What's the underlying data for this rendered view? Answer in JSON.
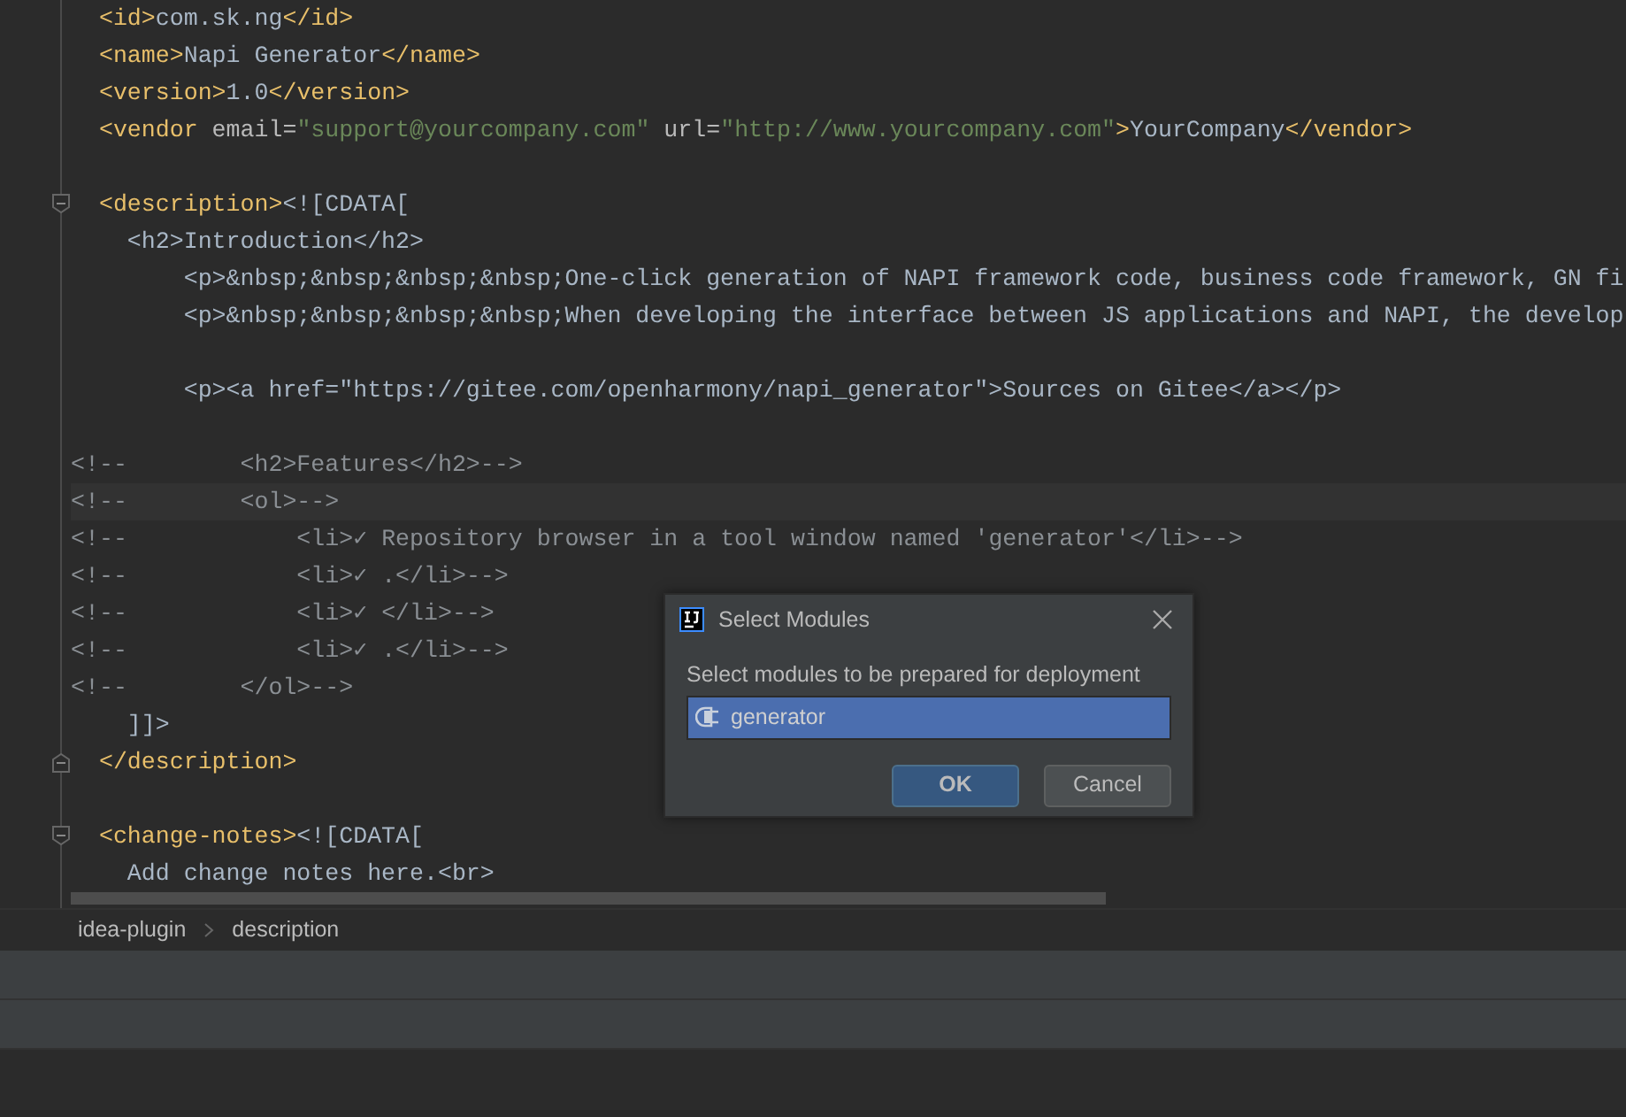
{
  "editor": {
    "lines": [
      {
        "kind": "code",
        "segments": [
          {
            "kind": "tag",
            "text": "  <id>"
          },
          {
            "kind": "text",
            "text": "com.sk.ng"
          },
          {
            "kind": "tag",
            "text": "</id>"
          }
        ]
      },
      {
        "kind": "code",
        "segments": [
          {
            "kind": "tag",
            "text": "  <name>"
          },
          {
            "kind": "text",
            "text": "Napi Generator"
          },
          {
            "kind": "tag",
            "text": "</name>"
          }
        ]
      },
      {
        "kind": "code",
        "segments": [
          {
            "kind": "tag",
            "text": "  <version>"
          },
          {
            "kind": "text",
            "text": "1.0"
          },
          {
            "kind": "tag",
            "text": "</version>"
          }
        ]
      },
      {
        "kind": "code",
        "segments": [
          {
            "kind": "tag",
            "text": "  <vendor"
          },
          {
            "kind": "attr",
            "text": " email="
          },
          {
            "kind": "string",
            "text": "\"support@yourcompany.com\""
          },
          {
            "kind": "attr",
            "text": " url="
          },
          {
            "kind": "string",
            "text": "\"http://www.yourcompany.com\""
          },
          {
            "kind": "tag",
            "text": ">"
          },
          {
            "kind": "text",
            "text": "YourCompany"
          },
          {
            "kind": "tag",
            "text": "</vendor>"
          }
        ]
      },
      {
        "kind": "blank"
      },
      {
        "kind": "code",
        "fold_start": true,
        "segments": [
          {
            "kind": "tag",
            "text": "  <description>"
          },
          {
            "kind": "text",
            "text": "<![CDATA["
          }
        ]
      },
      {
        "kind": "code",
        "segments": [
          {
            "kind": "text",
            "text": "    <h2>Introduction</h2>"
          }
        ]
      },
      {
        "kind": "code",
        "segments": [
          {
            "kind": "text",
            "text": "        <p>&nbsp;&nbsp;&nbsp;&nbsp;One-click generation of NAPI framework code, business code framework, GN fi"
          }
        ]
      },
      {
        "kind": "code",
        "segments": [
          {
            "kind": "text",
            "text": "        <p>&nbsp;&nbsp;&nbsp;&nbsp;When developing the interface between JS applications and NAPI, the develop"
          }
        ]
      },
      {
        "kind": "blank"
      },
      {
        "kind": "code",
        "segments": [
          {
            "kind": "text",
            "text": "        <p><a href=\"https://gitee.com/openharmony/napi_generator\">Sources on Gitee</a></p>"
          }
        ]
      },
      {
        "kind": "blank"
      },
      {
        "kind": "code",
        "segments": [
          {
            "kind": "comment",
            "text": "<!--        <h2>Features</h2>-->"
          }
        ]
      },
      {
        "kind": "code",
        "current": true,
        "segments": [
          {
            "kind": "comment",
            "text": "<!--        <ol>-->"
          }
        ]
      },
      {
        "kind": "code",
        "segments": [
          {
            "kind": "comment",
            "text": "<!--            <li>✓ Repository browser in a tool window named 'generator'</li>-->"
          }
        ]
      },
      {
        "kind": "code",
        "segments": [
          {
            "kind": "comment",
            "text": "<!--            <li>✓ .</li>-->"
          }
        ]
      },
      {
        "kind": "code",
        "segments": [
          {
            "kind": "comment",
            "text": "<!--            <li>✓ </li>-->"
          }
        ]
      },
      {
        "kind": "code",
        "segments": [
          {
            "kind": "comment",
            "text": "<!--            <li>✓ .</li>-->"
          }
        ]
      },
      {
        "kind": "code",
        "segments": [
          {
            "kind": "comment",
            "text": "<!--        </ol>-->"
          }
        ]
      },
      {
        "kind": "code",
        "segments": [
          {
            "kind": "text",
            "text": "    ]]>"
          }
        ]
      },
      {
        "kind": "code",
        "fold_end": true,
        "segments": [
          {
            "kind": "tag",
            "text": "  </description>"
          }
        ]
      },
      {
        "kind": "blank"
      },
      {
        "kind": "code",
        "fold_start": true,
        "segments": [
          {
            "kind": "tag",
            "text": "  <change-notes>"
          },
          {
            "kind": "text",
            "text": "<![CDATA["
          }
        ]
      },
      {
        "kind": "code",
        "segments": [
          {
            "kind": "text",
            "text": "    Add change notes here.<br>"
          }
        ]
      }
    ]
  },
  "breadcrumbs": [
    "idea-plugin",
    "description"
  ],
  "dialog": {
    "title": "Select Modules",
    "prompt": "Select modules to be prepared for deployment",
    "modules": [
      {
        "label": "generator",
        "selected": true
      }
    ],
    "buttons": [
      {
        "label": "OK",
        "kind": "primary"
      },
      {
        "label": "Cancel",
        "kind": "secondary"
      }
    ]
  }
}
